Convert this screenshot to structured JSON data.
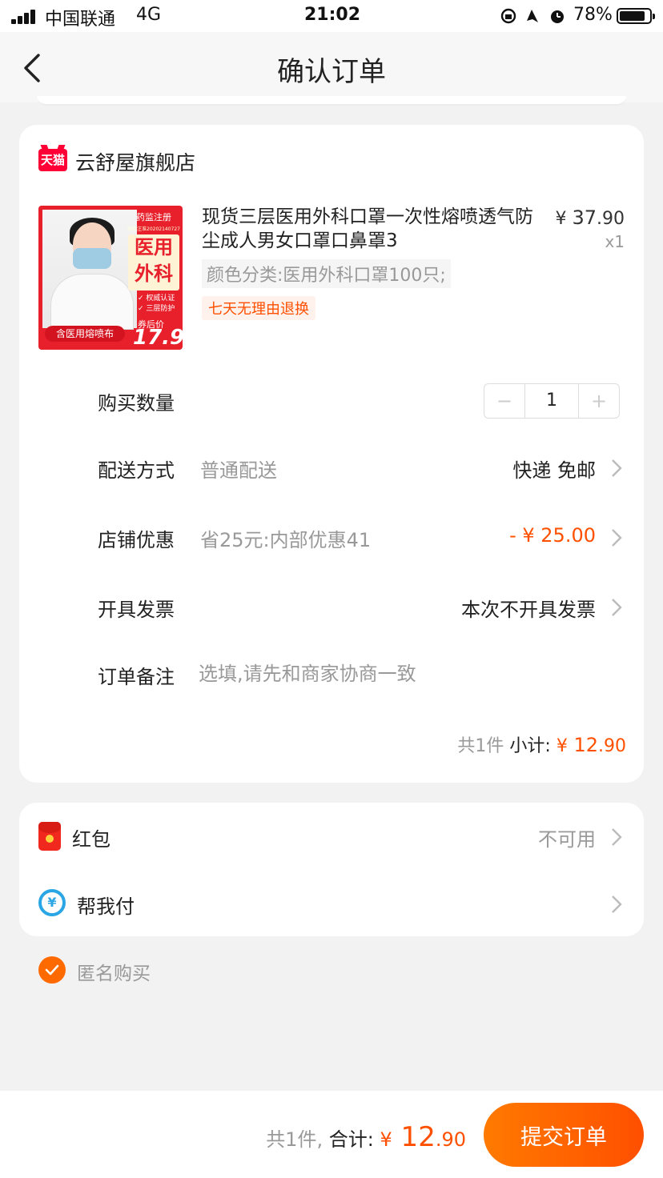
{
  "status_bar": {
    "carrier": "中国联通",
    "network": "4G",
    "time": "21:02",
    "battery": "78%"
  },
  "nav": {
    "title": "确认订单"
  },
  "store": {
    "name": "云舒屋旗舰店",
    "logo_text": "天猫"
  },
  "product": {
    "image_texts": {
      "tag": "药监注册",
      "tag_small": "湘械注准20202140727",
      "big_line1": "医用",
      "big_line2": "外科",
      "check1": "✓ 权威认证",
      "check2": "✓ 三层防护",
      "bottom": "含医用熔喷布",
      "price_label": "券后价",
      "price": "17.9"
    },
    "title": "现货三层医用外科口罩一次性熔喷透气防尘成人男女口罩口鼻罩3",
    "price_symbol": "¥",
    "price_int": "37",
    "price_dec": ".90",
    "quantity_label": "x1",
    "sku": "颜色分类:医用外科口罩100只;",
    "badge": "七天无理由退换"
  },
  "rows": {
    "quantity": {
      "label": "购买数量",
      "value": "1",
      "minus": "−",
      "plus": "+"
    },
    "delivery": {
      "label": "配送方式",
      "sub": "普通配送",
      "value": "快递 免邮"
    },
    "discount": {
      "label": "店铺优惠",
      "sub": "省25元:内部优惠41",
      "value": "- ¥ 25.00"
    },
    "invoice": {
      "label": "开具发票",
      "value": "本次不开具发票"
    },
    "remark": {
      "label": "订单备注",
      "placeholder": "选填,请先和商家协商一致"
    }
  },
  "subtotal": {
    "count": "共1件",
    "label": "小计:",
    "symbol": "¥",
    "int": " 12",
    "dec": ".90"
  },
  "payment": {
    "red_packet": {
      "label": "红包",
      "value": "不可用"
    },
    "pay_for_me": {
      "label": "帮我付",
      "icon_text": "¥"
    }
  },
  "anonymous": {
    "label": "匿名购买",
    "checked": true
  },
  "footer": {
    "count": "共1件,",
    "label": "合计:",
    "symbol": "¥",
    "int": " 12",
    "dec": ".90",
    "submit": "提交订单"
  },
  "colors": {
    "accent": "#ff5000",
    "tmall_red": "#ff0036",
    "background": "#f2f2f2"
  }
}
